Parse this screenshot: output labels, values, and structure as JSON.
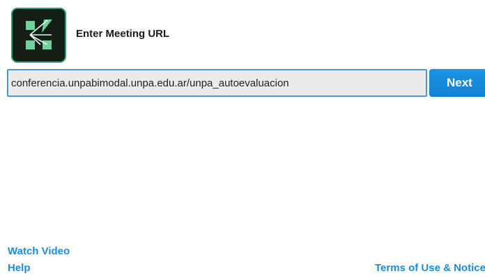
{
  "header": {
    "logo_icon": "adobe-connect-icon",
    "title": "Enter Meeting URL"
  },
  "meeting_url": {
    "value": "conferencia.unpabimodal.unpa.edu.ar/unpa_autoevaluacion"
  },
  "actions": {
    "next_label": "Next"
  },
  "footer": {
    "watch_video_label": "Watch Video",
    "help_label": "Help",
    "terms_label": "Terms of Use & Notices"
  },
  "colors": {
    "accent_blue": "#1d8ce0",
    "logo_green": "#2f9a6e",
    "logo_background": "#151e15"
  }
}
